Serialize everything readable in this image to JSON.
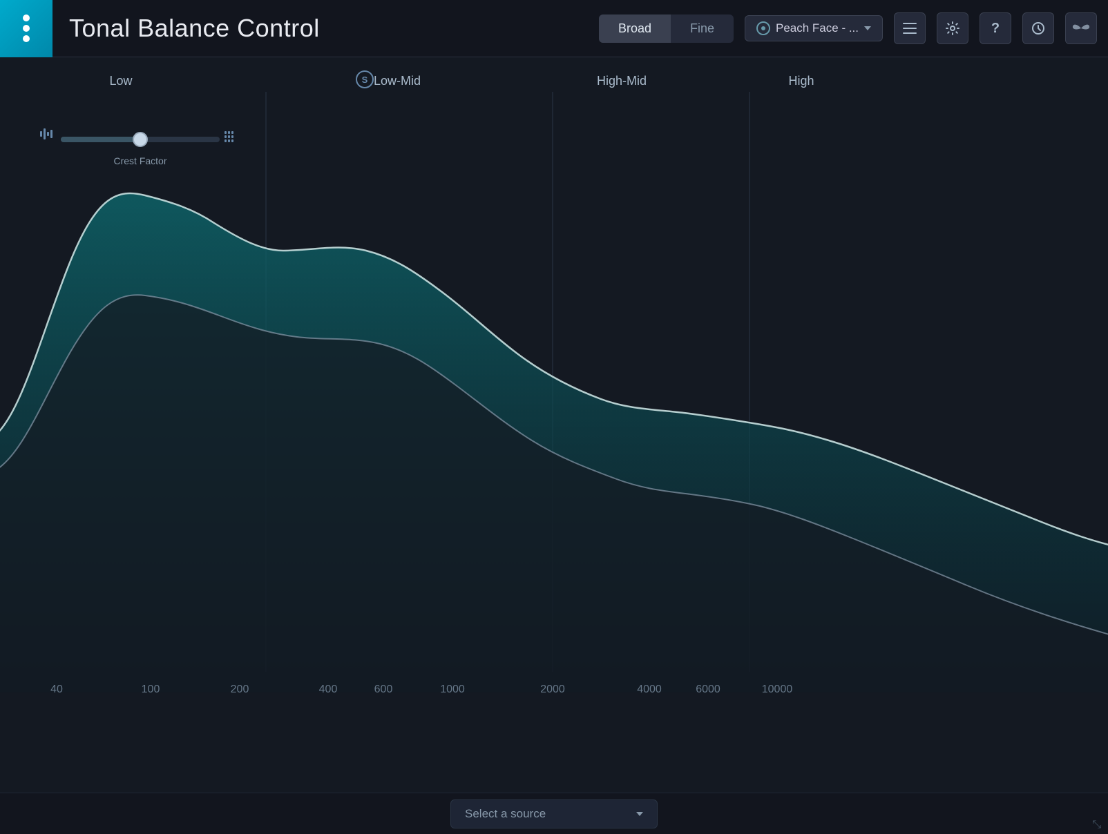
{
  "header": {
    "title": "Tonal Balance Control",
    "mode_broad": "Broad",
    "mode_fine": "Fine",
    "preset_label": "Peach Face - ...",
    "hamburger_label": "menu",
    "settings_label": "settings",
    "help_label": "help",
    "history_label": "undo history",
    "wings_label": "wings"
  },
  "bands": {
    "low_label": "Low",
    "low_mid_label": "Low-Mid",
    "high_mid_label": "High-Mid",
    "high_label": "High"
  },
  "crest": {
    "label": "Crest Factor"
  },
  "freq_labels": [
    "40",
    "100",
    "200",
    "400",
    "600",
    "1000",
    "2000",
    "4000",
    "6000",
    "10000"
  ],
  "bottom": {
    "source_placeholder": "Select a source",
    "source_dropdown_label": "Select a source"
  },
  "colors": {
    "accent": "#00aacc",
    "teal_fill": "#0d4a50",
    "teal_stroke": "#7ecfcf",
    "bg_dark": "#141922",
    "header_bg": "#12151e"
  }
}
